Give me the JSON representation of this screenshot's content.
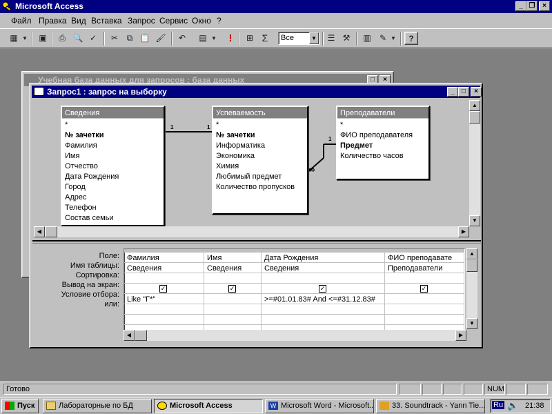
{
  "app": {
    "title": "Microsoft Access"
  },
  "menu": [
    "Файл",
    "Правка",
    "Вид",
    "Вставка",
    "Запрос",
    "Сервис",
    "Окно",
    "?"
  ],
  "toolbar": {
    "combo_value": "Все",
    "sigma": "Σ",
    "run": "!"
  },
  "back_window": {
    "title": "Учебная база данных для запросов : база данных"
  },
  "query_window": {
    "title": "Запрос1 : запрос на выборку"
  },
  "tables": [
    {
      "name": "Сведения",
      "fields": [
        "*",
        "№ зачетки",
        "Фамилия",
        "Имя",
        "Отчество",
        "Дата Рождения",
        "Город",
        "Адрес",
        "Телефон",
        "Состав семьи"
      ]
    },
    {
      "name": "Успеваемость",
      "fields": [
        "*",
        "№ зачетки",
        "Информатика",
        "Экономика",
        "Химия",
        "Любимый предмет",
        "Количество пропусков"
      ]
    },
    {
      "name": "Преподаватели",
      "fields": [
        "*",
        "ФИО преподавателя",
        "Предмет",
        "Количество часов"
      ]
    }
  ],
  "relations": {
    "one": "1",
    "many": "∞"
  },
  "grid": {
    "row_labels": [
      "Поле:",
      "Имя таблицы:",
      "Сортировка:",
      "Вывод на экран:",
      "Условие отбора:",
      "или:"
    ],
    "columns": [
      {
        "field": "Фамилия",
        "table": "Сведения",
        "criteria": "Like \"Г*\""
      },
      {
        "field": "Имя",
        "table": "Сведения",
        "criteria": ""
      },
      {
        "field": "Дата Рождения",
        "table": "Сведения",
        "criteria": ">=#01.01.83# And <=#31.12.83#"
      },
      {
        "field": "ФИО преподавате",
        "table": "Преподаватели",
        "criteria": ""
      }
    ]
  },
  "status": {
    "text": "Готово",
    "num": "NUM"
  },
  "taskbar": {
    "start": "Пуск",
    "tasks": [
      "Лабораторные по БД",
      "Microsoft Access",
      "Microsoft Word - Microsoft...",
      "33. Soundtrack - Yann Tie..."
    ],
    "lang": "Ru",
    "clock": "21:38"
  }
}
